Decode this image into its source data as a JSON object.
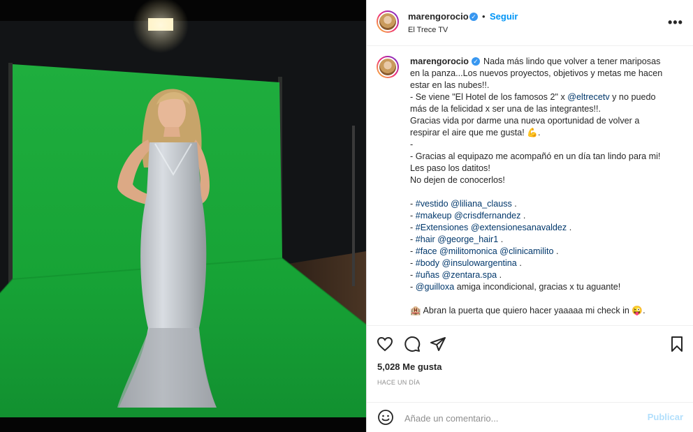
{
  "post": {
    "username": "marengorocio",
    "follow_label": "Seguir",
    "separator": "•",
    "location": "El Trece TV",
    "more_label": "•••",
    "verified_mark": "✓"
  },
  "caption": {
    "username": "marengorocio",
    "lines": [
      {
        "pre": "Nada más lindo que volver a tener mariposas",
        "mention": "",
        "post": ""
      },
      {
        "pre": "en la panza...Los nuevos proyectos, objetivos y metas me hacen",
        "mention": "",
        "post": ""
      },
      {
        "pre": "estar en las nubes!!.",
        "mention": "",
        "post": ""
      },
      {
        "pre": "- Se viene \"El Hotel de los famosos 2\" x ",
        "mention": "@eltrecetv",
        "post": " y no puedo"
      },
      {
        "pre": "más de la felicidad x ser una de las integrantes!!.",
        "mention": "",
        "post": ""
      },
      {
        "pre": "Gracias vida por darme una nueva oportunidad de volver a",
        "mention": "",
        "post": ""
      },
      {
        "pre": "respirar el aire que me gusta! 💪.",
        "mention": "",
        "post": ""
      },
      {
        "pre": "-",
        "mention": "",
        "post": ""
      },
      {
        "pre": "- Gracias al equipazo me acompañó en un día tan lindo para mi!",
        "mention": "",
        "post": ""
      },
      {
        "pre": "Les paso los datitos!",
        "mention": "",
        "post": ""
      },
      {
        "pre": "No dejen de conocerlos!",
        "mention": "",
        "post": ""
      },
      {
        "pre": "",
        "mention": "",
        "post": ""
      },
      {
        "pre": "- ",
        "mention": "#vestido @liliana_clauss",
        "post": " ."
      },
      {
        "pre": "- ",
        "mention": "#makeup @crisdfernandez",
        "post": " ."
      },
      {
        "pre": "- ",
        "mention": "#Extensiones @extensionesanavaldez",
        "post": " ."
      },
      {
        "pre": "- ",
        "mention": "#hair @george_hair1",
        "post": " ."
      },
      {
        "pre": "- ",
        "mention": "#face @militomonica @clinicamilito",
        "post": " ."
      },
      {
        "pre": "- ",
        "mention": "#body @insulowargentina",
        "post": " ."
      },
      {
        "pre": "- ",
        "mention": "#uñas @zentara.spa",
        "post": " ."
      },
      {
        "pre": "- ",
        "mention": "@guilloxa",
        "post": " amiga incondicional, gracias x tu aguante!"
      },
      {
        "pre": "",
        "mention": "",
        "post": ""
      },
      {
        "pre": "🏨 Abran la puerta que quiero hacer yaaaaa mi check in 😜.",
        "mention": "",
        "post": ""
      }
    ]
  },
  "actions": {
    "likes": "5,028 Me gusta",
    "timestamp": "HACE UN DÍA"
  },
  "comment": {
    "placeholder": "Añade un comentario...",
    "publish_label": "Publicar"
  },
  "colors": {
    "link": "#0095f6",
    "mention": "#00376b",
    "verified": "#3897f0",
    "publish_disabled": "#b2dffc",
    "green_screen": "#17a93a"
  }
}
